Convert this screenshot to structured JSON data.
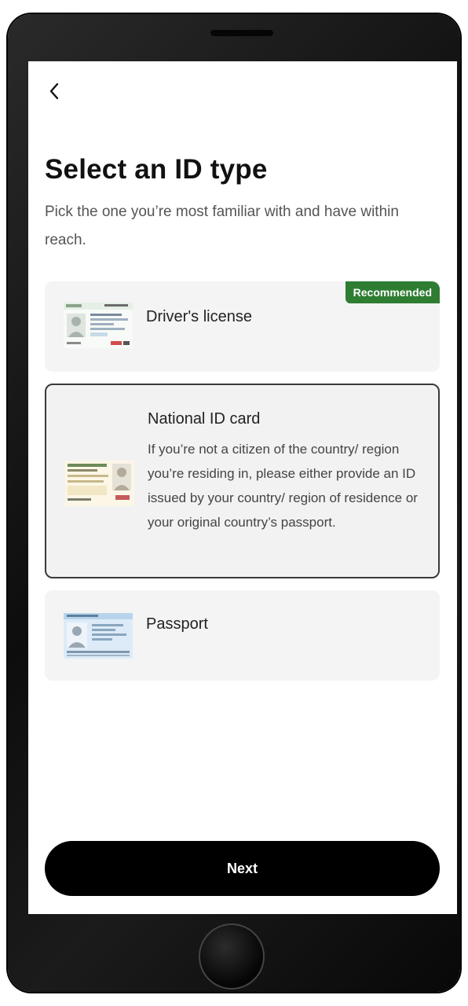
{
  "header": {
    "back_icon": "chevron-left-icon"
  },
  "page": {
    "title": "Select an ID type",
    "subtitle": "Pick the one you’re most familiar with and have within reach."
  },
  "options": [
    {
      "label": "Driver's license",
      "badge": "Recommended",
      "icon": "drivers-license-icon"
    },
    {
      "label": "National ID card",
      "description": "If you’re not a citizen of the country/ region you’re residing in, please either provide an ID issued by your country/ region of residence or your original country’s passport.",
      "icon": "national-id-card-icon",
      "selected": true
    },
    {
      "label": "Passport",
      "icon": "passport-icon"
    }
  ],
  "footer": {
    "next_label": "Next"
  },
  "colors": {
    "badge": "#2e7d32",
    "button": "#000000",
    "option_bg": "#f4f4f4"
  }
}
